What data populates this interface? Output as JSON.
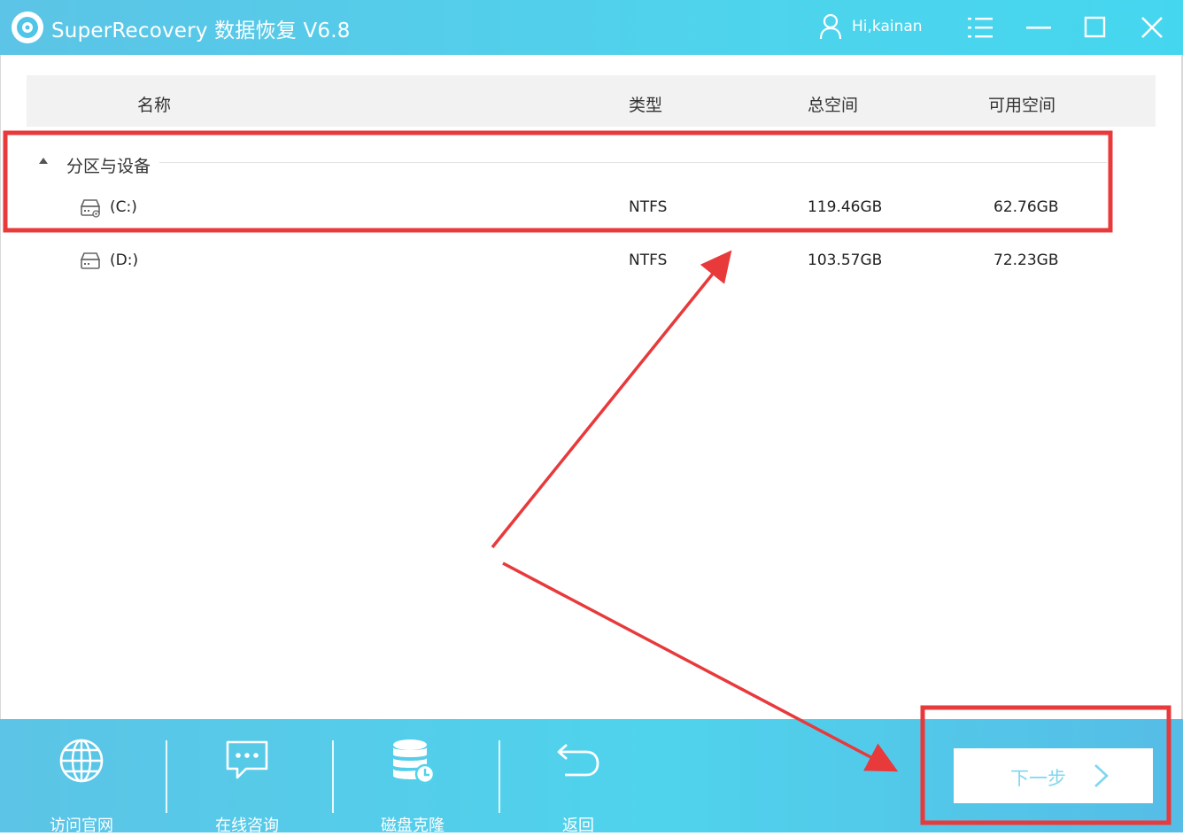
{
  "window": {
    "title": "SuperRecovery 数据恢复 V6.8",
    "user_greeting": "Hi,kainan",
    "icons": [
      "app-logo-icon",
      "user-icon",
      "menu-icon",
      "minimize-icon",
      "maximize-icon",
      "close-icon"
    ]
  },
  "table": {
    "headers": {
      "name": "名称",
      "type": "类型",
      "total": "总空间",
      "free": "可用空间"
    },
    "group": {
      "label": "分区与设备",
      "expanded": true
    },
    "drives": [
      {
        "name": "(C:)",
        "type": "NTFS",
        "total": "119.46GB",
        "free": "62.76GB",
        "icon": "system-drive-icon"
      },
      {
        "name": "(D:)",
        "type": "NTFS",
        "total": "103.57GB",
        "free": "72.23GB",
        "icon": "hard-drive-icon"
      }
    ]
  },
  "bottom": {
    "tools": [
      {
        "label": "访问官网",
        "icon": "globe-icon"
      },
      {
        "label": "在线咨询",
        "icon": "chat-icon"
      },
      {
        "label": "磁盘克隆",
        "icon": "database-icon"
      },
      {
        "label": "返回",
        "icon": "back-arrow-icon"
      }
    ],
    "next_label": "下一步",
    "next_icon": "chevron-right-icon"
  },
  "annotation": {
    "color": "#e8393b",
    "type": "red-highlight-boxes-and-arrows"
  }
}
